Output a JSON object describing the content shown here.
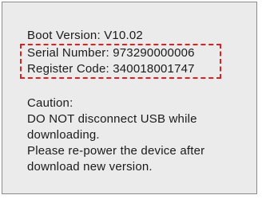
{
  "device_info": {
    "boot_version": "Boot Version: V10.02",
    "serial_number": "Serial Number: 973290000006",
    "register_code": "Register Code: 340018001747",
    "highlight_color": "#e02020"
  },
  "caution": {
    "heading": "Caution:",
    "lines": [
      "DO NOT disconnect USB while",
      "downloading.",
      "Please re-power the device after",
      "download new version."
    ]
  }
}
